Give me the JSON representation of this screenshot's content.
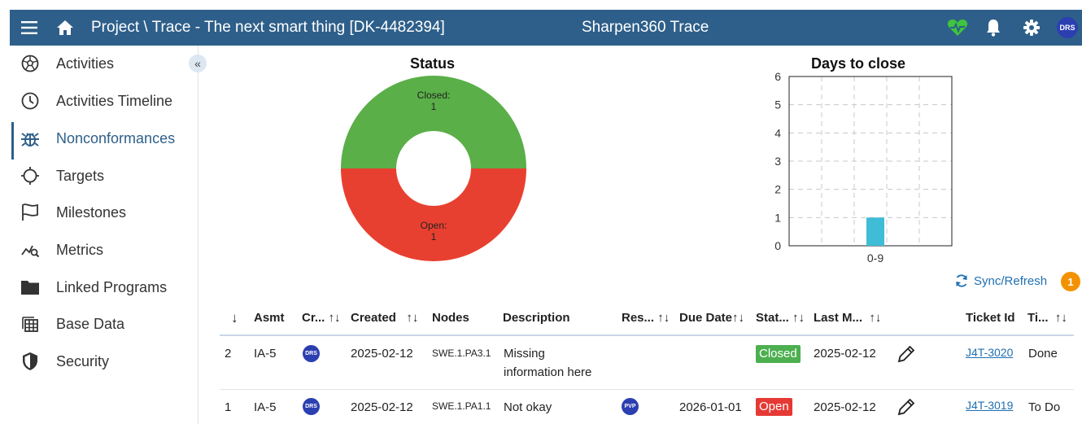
{
  "header": {
    "title": "Project \\ Trace - The next smart thing [DK-4482394]",
    "app_title": "Sharpen360 Trace",
    "user_initials": "DRS",
    "icons": [
      "menu-icon",
      "home-icon",
      "heartbeat-icon",
      "bell-icon",
      "gear-icon"
    ],
    "heartbeat_color": "#3ec43e",
    "bar_color": "#2e5f8a"
  },
  "sidebar": {
    "collapse_label": "«",
    "items": [
      {
        "label": "Activities",
        "icon": "soccer-ball-icon"
      },
      {
        "label": "Activities Timeline",
        "icon": "clock-icon"
      },
      {
        "label": "Nonconformances",
        "icon": "bug-icon",
        "active": true
      },
      {
        "label": "Targets",
        "icon": "crosshair-icon"
      },
      {
        "label": "Milestones",
        "icon": "flag-icon"
      },
      {
        "label": "Metrics",
        "icon": "chart-search-icon"
      },
      {
        "label": "Linked Programs",
        "icon": "folder-icon"
      },
      {
        "label": "Base Data",
        "icon": "table-icon"
      },
      {
        "label": "Security",
        "icon": "shield-icon"
      }
    ]
  },
  "chart_data": [
    {
      "type": "pie",
      "title": "Status",
      "labels": [
        "Closed:",
        "Open:"
      ],
      "values": [
        1,
        1
      ],
      "colors": [
        "#5aaf48",
        "#e84030"
      ],
      "donut": true
    },
    {
      "type": "bar",
      "title": "Days to close",
      "categories": [
        "0-9"
      ],
      "values": [
        1
      ],
      "ylim": [
        0,
        6
      ],
      "yticks": [
        "0",
        "1",
        "2",
        "3",
        "4",
        "5",
        "6"
      ],
      "grid": true,
      "bar_color": "#3fbcd6"
    }
  ],
  "sync": {
    "label": "Sync/Refresh",
    "badge": "1",
    "icon": "refresh-icon"
  },
  "table": {
    "sort_icon": "↓",
    "columns": [
      {
        "label": "Asmt",
        "sort": ""
      },
      {
        "label": "Cr...",
        "sort": "↑↓"
      },
      {
        "label": "Created",
        "sort": "↑↓"
      },
      {
        "label": "Nodes",
        "sort": ""
      },
      {
        "label": "Description",
        "sort": ""
      },
      {
        "label": "Res...",
        "sort": "↑↓"
      },
      {
        "label": "Due Date",
        "sort": "↑↓"
      },
      {
        "label": "Stat...",
        "sort": "↑↓"
      },
      {
        "label": "Last M...",
        "sort": "↑↓"
      },
      {
        "label": "Ticket Id",
        "sort": ""
      },
      {
        "label": "Ti...",
        "sort": "↑↓"
      }
    ],
    "rows": [
      {
        "index": "2",
        "asmt": "IA-5",
        "creator": "DRS",
        "created": "2025-02-12",
        "nodes": "SWE.1.PA3.1",
        "description_1": "Missing",
        "description_2": "information here",
        "responsible": "",
        "due_date": "",
        "status": "Closed",
        "last_modified": "2025-02-12",
        "ticket_id": "J4T-3020",
        "ticket_status": "Done"
      },
      {
        "index": "1",
        "asmt": "IA-5",
        "creator": "DRS",
        "created": "2025-02-12",
        "nodes": "SWE.1.PA1.1",
        "description_1": "Not okay",
        "description_2": "",
        "responsible": "PVP",
        "due_date": "2026-01-01",
        "status": "Open",
        "last_modified": "2025-02-12",
        "ticket_id": "J4T-3019",
        "ticket_status": "To Do"
      }
    ]
  }
}
